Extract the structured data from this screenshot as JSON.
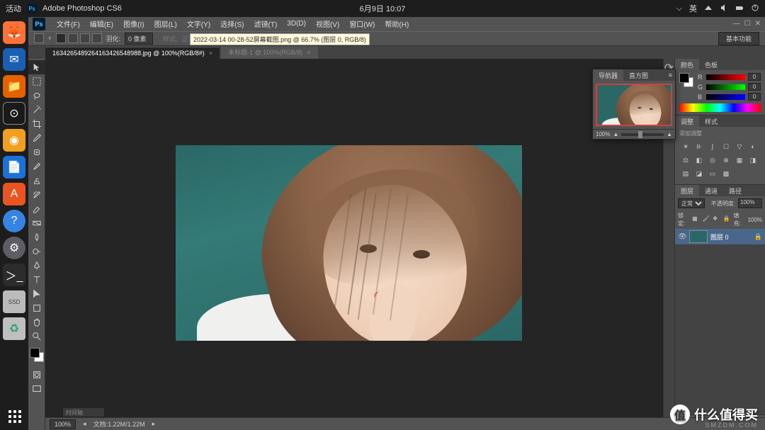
{
  "ubuntu": {
    "activities": "活动",
    "app_title": "Adobe Photoshop CS6",
    "datetime": "6月9日 10:07",
    "input_method": "英"
  },
  "dock": {
    "ssd_label": "SSD"
  },
  "ps": {
    "menus": [
      "文件(F)",
      "编辑(E)",
      "图像(I)",
      "图层(L)",
      "文字(Y)",
      "选择(S)",
      "滤镜(T)",
      "3D(D)",
      "视图(V)",
      "窗口(W)",
      "帮助(H)"
    ],
    "options": {
      "feather_label": "羽化:",
      "feather_value": "0 像素",
      "style_label": "样式:",
      "style_value": "正常",
      "right_label": "基本功能"
    },
    "tooltip": "2022-03-14 00-28-52屏幕截图.png @ 66.7% (图层 0, RGB/8)",
    "tabs": {
      "active": "163426548926416342654898​8.jpg @ 100%(RGB/8#)",
      "inactive": "未标题-1 @ 100%(RGB/8)"
    },
    "navigator": {
      "tab1": "导航器",
      "tab2": "直方图",
      "zoom": "100%"
    },
    "panels": {
      "color_tab": "颜色",
      "swatch_tab": "色板",
      "r": "R",
      "g": "G",
      "b": "B",
      "r_val": "0",
      "g_val": "0",
      "b_val": "0",
      "adj_tab": "调整",
      "style_tab": "样式",
      "adj_title": "添加调整",
      "layers_tab": "图层",
      "channels_tab": "通道",
      "paths_tab": "路径",
      "blend_mode": "正常",
      "opacity_label": "不透明度:",
      "opacity_val": "100%",
      "lock_label": "锁定:",
      "fill_label": "填充:",
      "fill_val": "100%",
      "layer_name": "图层 0"
    },
    "status": {
      "zoom": "100%",
      "docinfo": "文档:1.22M/1.22M"
    },
    "collapsed": "时间轴"
  },
  "watermark": {
    "text": "什么值得买",
    "badge": "值",
    "sub": "SMZDM.COM"
  }
}
